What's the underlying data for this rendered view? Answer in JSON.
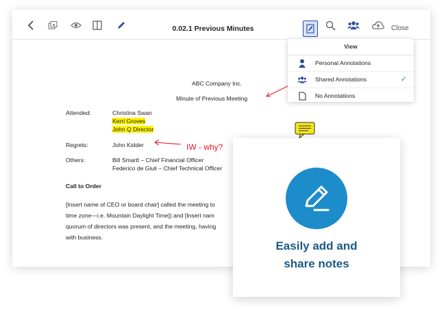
{
  "toolbar": {
    "title": "0.02.1  Previous Minutes",
    "close_label": "Close"
  },
  "view_menu": {
    "title": "View",
    "items": [
      {
        "label": "Personal Annotations",
        "icon": "person-icon",
        "checked": false
      },
      {
        "label": "Shared Annotations",
        "icon": "group-icon",
        "checked": true
      },
      {
        "label": "No Annotations",
        "icon": "blank-page-icon",
        "checked": false
      }
    ],
    "check_mark": "✓"
  },
  "document": {
    "company": "ABC Company Inc.",
    "heading": "Minute of Previous Meeting",
    "attended_label": "Attended:",
    "attended": [
      "Christina Swan",
      "Kerri Groves",
      "John Q Director"
    ],
    "regrets_label": "Regrets:",
    "regrets": "John Kidder",
    "others_label": "Others:",
    "others": [
      "Bill Smartt – Chief Financial Officer",
      "Federico de Giuli – Chief Technical Officer"
    ],
    "call_to_order": "Call to Order",
    "body_lines": [
      "[Insert name of CEO or board chair] called the meeting to",
      "time zone—i.e. Mountain Daylight Time]) and [Insert nam",
      "quorum of directors was present, and the meeting, having",
      "with business."
    ],
    "handwritten_note": "IW - why?"
  },
  "callout": {
    "line1": "Easily add and",
    "line2": "share notes"
  },
  "colors": {
    "accent_blue": "#1d8cca",
    "callout_text": "#1b5a86",
    "highlight": "#fff200",
    "annotation_red": "#e8192c",
    "checkmark": "#2a7de1"
  }
}
